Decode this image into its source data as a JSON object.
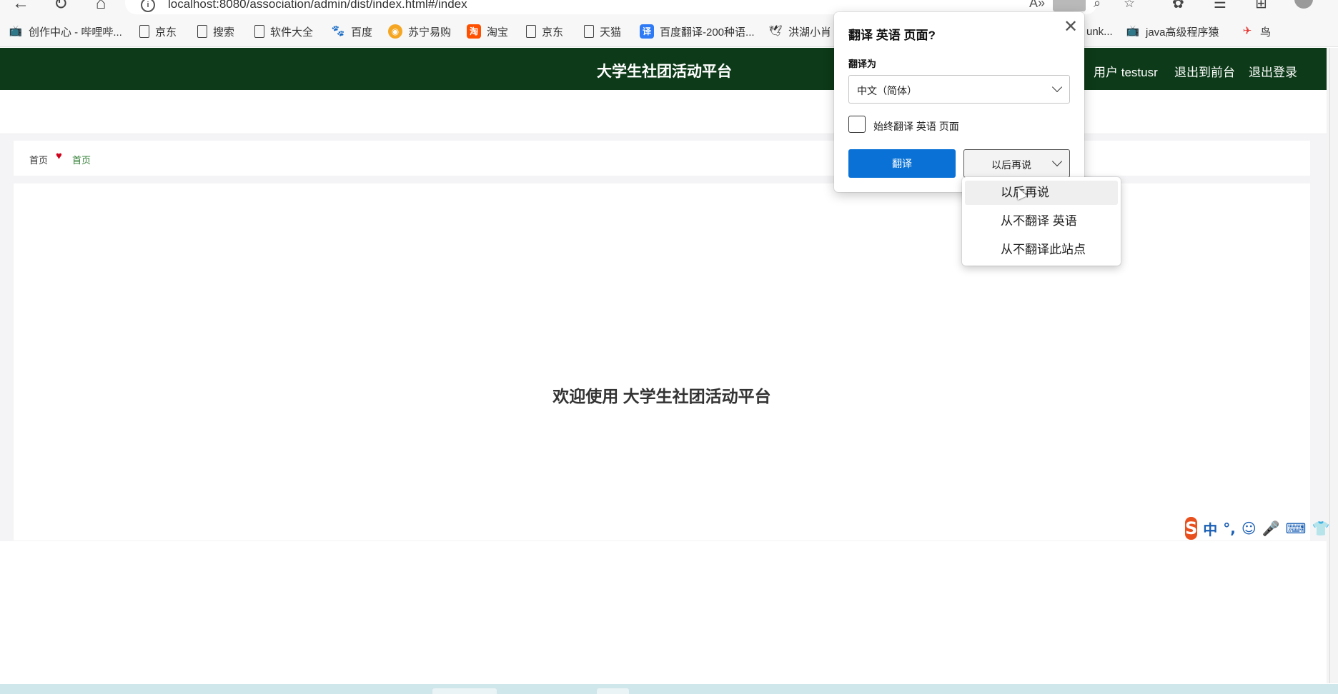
{
  "browser": {
    "url": "localhost:8080/association/admin/dist/index.html#/index",
    "bookmarks": [
      {
        "label": "创作中心 - 哔哩哔...",
        "icon": "bilibili-icon"
      },
      {
        "label": "京东",
        "icon": "page-icon"
      },
      {
        "label": "搜索",
        "icon": "page-icon"
      },
      {
        "label": "软件大全",
        "icon": "page-icon"
      },
      {
        "label": "百度",
        "icon": "baidu-paw-icon"
      },
      {
        "label": "苏宁易购",
        "icon": "suning-icon"
      },
      {
        "label": "淘宝",
        "icon": "taobao-icon"
      },
      {
        "label": "京东",
        "icon": "page-icon"
      },
      {
        "label": "天猫",
        "icon": "page-icon"
      },
      {
        "label": "百度翻译-200种语...",
        "icon": "baidu-translate-icon"
      },
      {
        "label": "洪湖小肖",
        "icon": "bird-icon"
      },
      {
        "label": "unk...",
        "icon": ""
      },
      {
        "label": "java高级程序猿",
        "icon": "bilibili-icon"
      },
      {
        "label": "鸟",
        "icon": "bird-red-icon"
      }
    ]
  },
  "header": {
    "title": "大学生社团活动平台",
    "user_label": "用户 testusr",
    "front_link": "退出到前台",
    "logout_link": "退出登录",
    "bg_color": "#0d3a18"
  },
  "breadcrumb": {
    "home": "首页",
    "current": "首页"
  },
  "main": {
    "welcome": "欢迎使用 大学生社团活动平台"
  },
  "translate_popup": {
    "title": "翻译 英语 页面?",
    "translate_to_label": "翻译为",
    "selected_language": "中文（简体）",
    "always_translate_label": "始终翻译 英语 页面",
    "always_translate_checked": false,
    "translate_button": "翻译",
    "later_button": "以后再说",
    "accent_color": "#0a72d6"
  },
  "later_menu": {
    "items": [
      "以后再说",
      "从不翻译 英语",
      "从不翻译此站点"
    ],
    "hovered_index": 0
  },
  "ime": {
    "items": [
      "中",
      "°,",
      "☺",
      "🎤",
      "⌨",
      "👕",
      "↑"
    ]
  }
}
